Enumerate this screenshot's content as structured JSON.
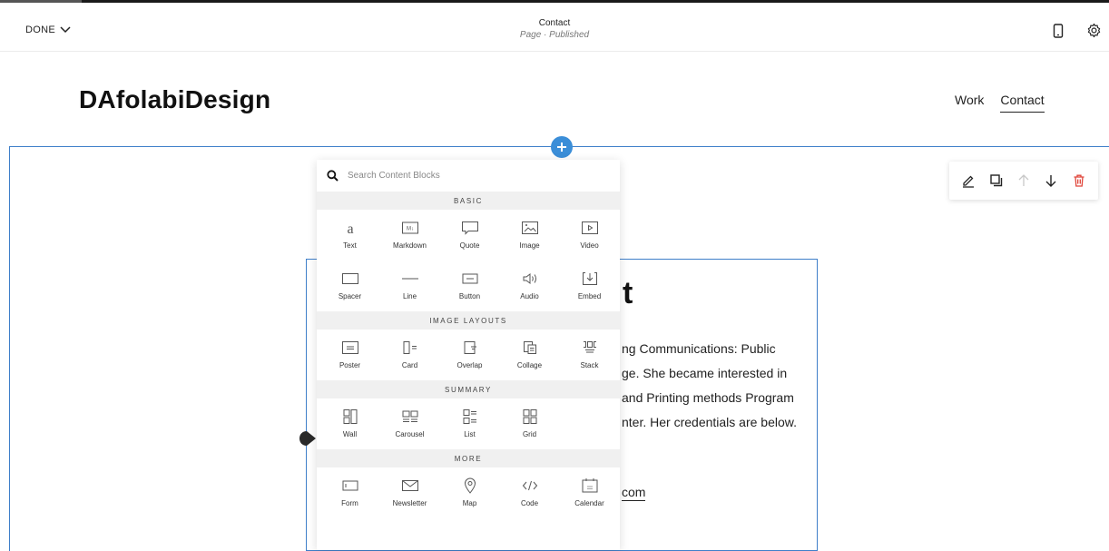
{
  "editor": {
    "done_label": "DONE",
    "page_title": "Contact",
    "page_status": "Page · Published"
  },
  "site": {
    "logo": "DAfolabiDesign",
    "nav": [
      "Work",
      "Contact"
    ],
    "active_nav": "Contact"
  },
  "block": {
    "heading_fragment": "t",
    "lines": [
      "ng Communications: Public",
      "ge. She became interested in",
      "and Printing methods Program",
      "nter. Her credentials are below."
    ],
    "link_fragment": "com"
  },
  "picker": {
    "search_placeholder": "Search Content Blocks",
    "categories": [
      {
        "name": "BASIC",
        "items": [
          {
            "label": "Text",
            "icon": "text-icon"
          },
          {
            "label": "Markdown",
            "icon": "markdown-icon"
          },
          {
            "label": "Quote",
            "icon": "quote-icon"
          },
          {
            "label": "Image",
            "icon": "image-icon"
          },
          {
            "label": "Video",
            "icon": "video-icon"
          },
          {
            "label": "Spacer",
            "icon": "spacer-icon"
          },
          {
            "label": "Line",
            "icon": "line-icon"
          },
          {
            "label": "Button",
            "icon": "button-icon"
          },
          {
            "label": "Audio",
            "icon": "audio-icon"
          },
          {
            "label": "Embed",
            "icon": "embed-icon"
          }
        ]
      },
      {
        "name": "IMAGE LAYOUTS",
        "items": [
          {
            "label": "Poster",
            "icon": "poster-icon"
          },
          {
            "label": "Card",
            "icon": "card-icon"
          },
          {
            "label": "Overlap",
            "icon": "overlap-icon"
          },
          {
            "label": "Collage",
            "icon": "collage-icon"
          },
          {
            "label": "Stack",
            "icon": "stack-icon"
          }
        ]
      },
      {
        "name": "SUMMARY",
        "items": [
          {
            "label": "Wall",
            "icon": "wall-icon"
          },
          {
            "label": "Carousel",
            "icon": "carousel-icon"
          },
          {
            "label": "List",
            "icon": "list-icon"
          },
          {
            "label": "Grid",
            "icon": "grid-icon"
          }
        ]
      },
      {
        "name": "MORE",
        "items": [
          {
            "label": "Form",
            "icon": "form-icon"
          },
          {
            "label": "Newsletter",
            "icon": "newsletter-icon"
          },
          {
            "label": "Map",
            "icon": "map-icon"
          },
          {
            "label": "Code",
            "icon": "code-icon"
          },
          {
            "label": "Calendar",
            "icon": "calendar-icon"
          }
        ]
      }
    ]
  },
  "colors": {
    "accent_blue": "#3b8ed8",
    "frame_blue": "#3f7fc9",
    "delete_red": "#e0453a"
  }
}
